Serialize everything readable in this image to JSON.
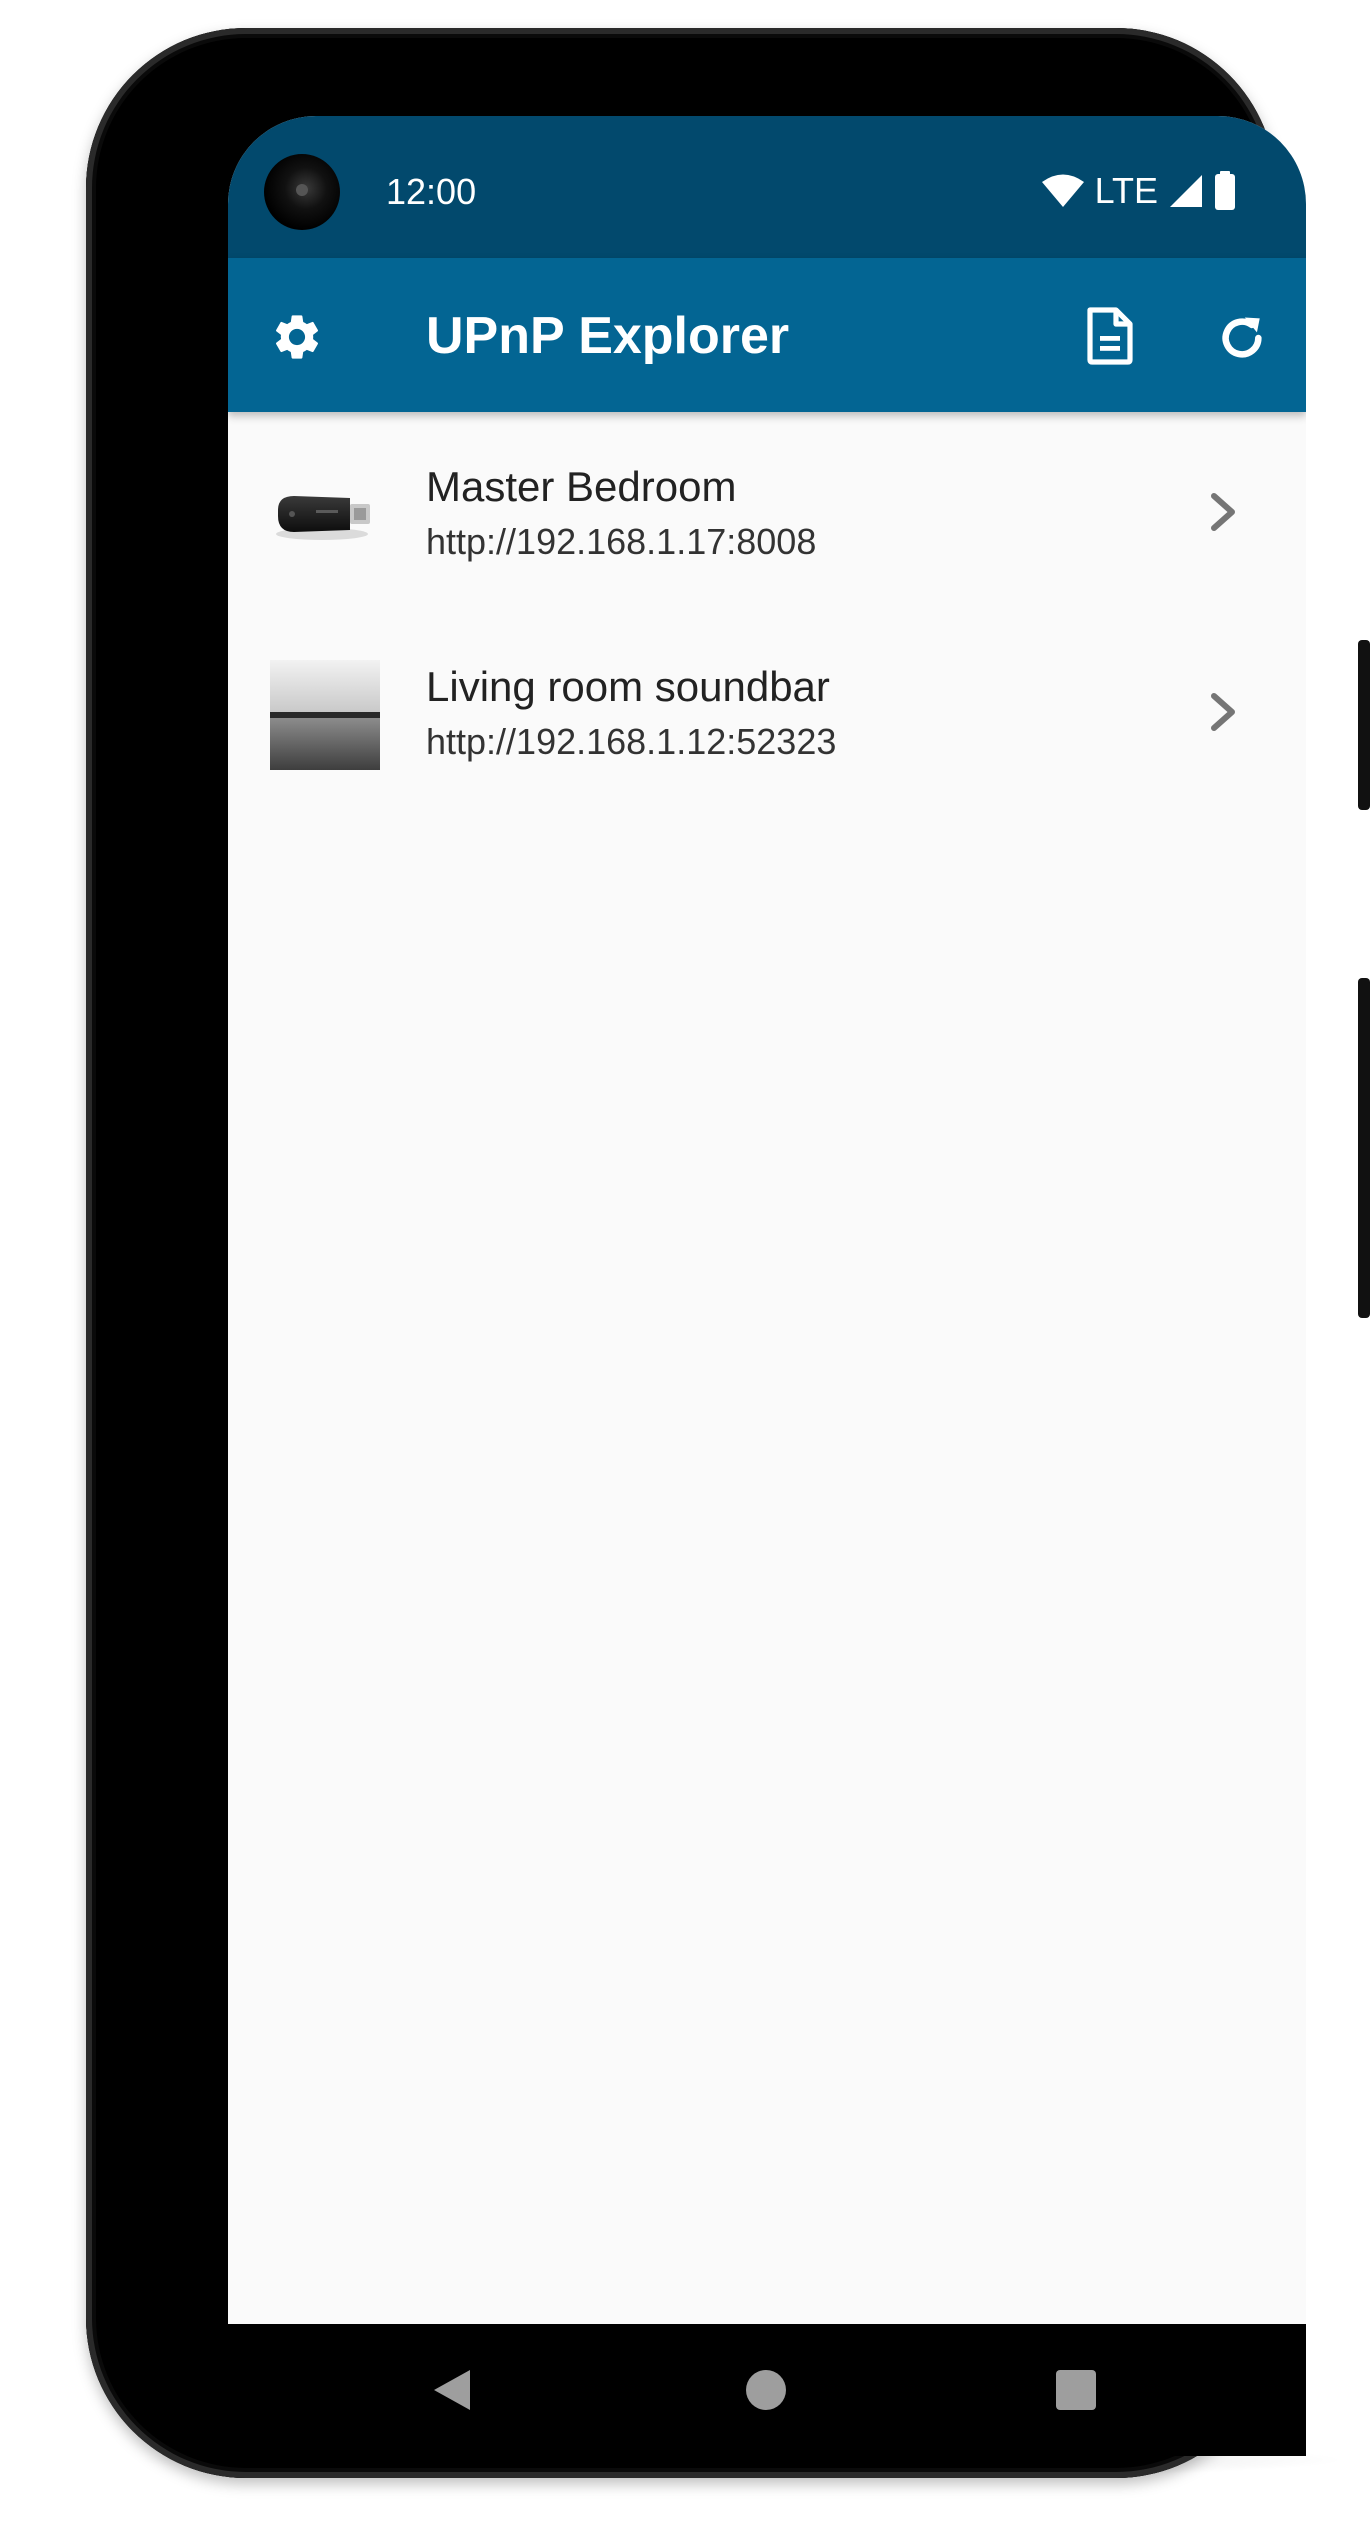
{
  "status_bar": {
    "time": "12:00",
    "network": "LTE",
    "icons": [
      "wifi-icon",
      "cellular-signal-icon",
      "battery-icon"
    ]
  },
  "app_bar": {
    "title": "UPnP Explorer",
    "icons": [
      "settings-icon",
      "document-icon",
      "refresh-icon"
    ]
  },
  "devices": [
    {
      "name": "Master Bedroom",
      "url": "http://192.168.1.17:8008",
      "icon": "chromecast-device-thumbnail"
    },
    {
      "name": "Living room soundbar",
      "url": "http://192.168.1.12:52323",
      "icon": "soundbar-device-thumbnail"
    }
  ],
  "nav_bar": {
    "icons": [
      "back-icon",
      "home-icon",
      "recents-icon"
    ]
  },
  "colors": {
    "status_bar": "#02496d",
    "app_bar": "#036593",
    "background": "#fafafa",
    "text_primary": "#222222",
    "text_secondary": "#333333",
    "chevron": "#757575"
  }
}
